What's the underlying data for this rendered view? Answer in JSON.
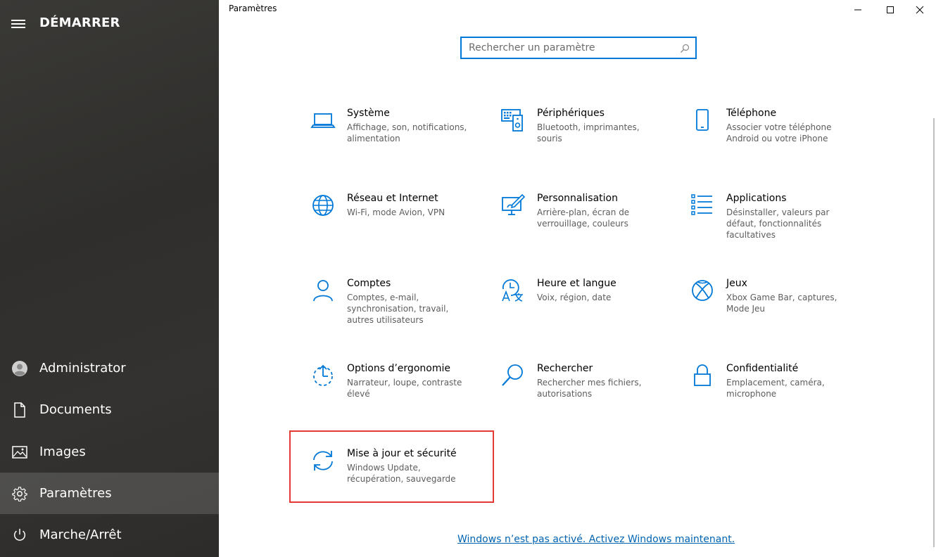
{
  "start_menu": {
    "title": "DÉMARRER",
    "items": [
      {
        "label": "Administrator",
        "icon": "user-avatar-icon"
      },
      {
        "label": "Documents",
        "icon": "document-icon"
      },
      {
        "label": "Images",
        "icon": "image-icon"
      },
      {
        "label": "Paramètres",
        "icon": "gear-icon",
        "active": true
      },
      {
        "label": "Marche/Arrêt",
        "icon": "power-icon"
      }
    ]
  },
  "window": {
    "title": "Paramètres",
    "controls": [
      "minimize",
      "maximize",
      "close"
    ]
  },
  "search": {
    "placeholder": "Rechercher un paramètre",
    "value": ""
  },
  "categories": [
    {
      "title": "Système",
      "desc": "Affichage, son, notifications, alimentation",
      "icon": "laptop-icon"
    },
    {
      "title": "Périphériques",
      "desc": "Bluetooth, imprimantes, souris",
      "icon": "devices-icon"
    },
    {
      "title": "Téléphone",
      "desc": "Associer votre téléphone Android ou votre iPhone",
      "icon": "phone-icon"
    },
    {
      "title": "Réseau et Internet",
      "desc": "Wi-Fi, mode Avion, VPN",
      "icon": "globe-icon"
    },
    {
      "title": "Personnalisation",
      "desc": "Arrière-plan, écran de verrouillage, couleurs",
      "icon": "paint-icon"
    },
    {
      "title": "Applications",
      "desc": "Désinstaller, valeurs par défaut, fonctionnalités facultatives",
      "icon": "apps-list-icon"
    },
    {
      "title": "Comptes",
      "desc": "Comptes, e-mail, synchronisation, travail, autres utilisateurs",
      "icon": "person-icon"
    },
    {
      "title": "Heure et langue",
      "desc": "Voix, région, date",
      "icon": "time-language-icon"
    },
    {
      "title": "Jeux",
      "desc": "Xbox Game Bar, captures, Mode Jeu",
      "icon": "xbox-icon"
    },
    {
      "title": "Options d’ergonomie",
      "desc": "Narrateur, loupe, contraste élevé",
      "icon": "ease-of-access-icon"
    },
    {
      "title": "Rechercher",
      "desc": "Rechercher mes fichiers, autorisations",
      "icon": "search-icon"
    },
    {
      "title": "Confidentialité",
      "desc": "Emplacement, caméra, microphone",
      "icon": "lock-icon"
    },
    {
      "title": "Mise à jour et sécurité",
      "desc": "Windows Update, récupération, sauvegarde",
      "icon": "update-icon",
      "highlighted": true
    }
  ],
  "activation_link": "Windows n’est pas activé. Activez Windows maintenant.",
  "colors": {
    "accent": "#0078d7",
    "highlight_border": "#e53935",
    "link": "#0063b1"
  }
}
